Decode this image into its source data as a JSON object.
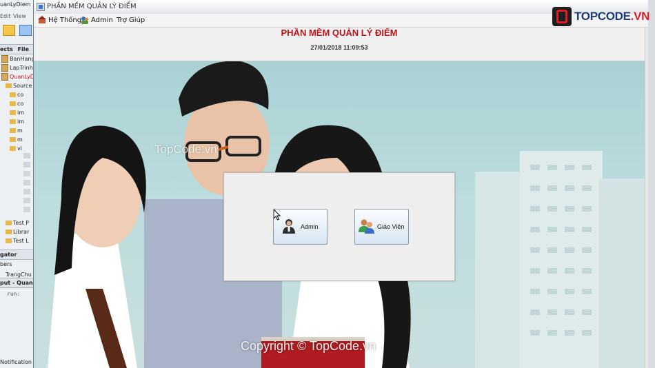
{
  "ide": {
    "top_items": [
      "uanLyDiem",
      "Edit",
      "View"
    ],
    "projects_header": "ects",
    "files_header": "File",
    "tree_items": [
      "BanHang",
      "LapTrinhM",
      "QuanLyDi",
      "Source",
      "co",
      "co",
      "im",
      "im",
      "m",
      "m",
      "vi",
      "Test P",
      "Librar",
      "Test L"
    ],
    "navigator_header": "gator",
    "members_header": "bers",
    "nav_item": "TrangChu",
    "output_header": "put - QuanL",
    "output_line": "run:",
    "notifications": "Notification"
  },
  "window": {
    "title": "PHẦN MỀM QUẢN LÝ ĐIỂM"
  },
  "menubar": {
    "items": [
      "Hệ Thống",
      "Admin",
      "Trợ Giúp"
    ]
  },
  "header": {
    "title": "PHẦN MỀM QUẢN LÝ ĐIỂM",
    "datetime": "27/01/2018 11:09:53"
  },
  "login_panel": {
    "admin_label": "Admin",
    "teacher_label": "Giáo Viên"
  },
  "watermarks": {
    "top": "TopCode.vn",
    "bottom": "Copyright © TopCode.vn"
  },
  "logo": {
    "text_main": "TOPCODE",
    "text_suffix": ".VN"
  },
  "colors": {
    "title_red": "#c0121a",
    "button_gradient_bottom": "#d6e4f2",
    "logo_blue": "#1c3a74",
    "logo_red": "#e11b22"
  },
  "icons": {
    "admin": "admin-user-icon",
    "teacher": "teacher-group-icon",
    "menu_system": "system-icon",
    "menu_admin": "admin-menu-icon",
    "cursor": "mouse-pointer-icon"
  }
}
